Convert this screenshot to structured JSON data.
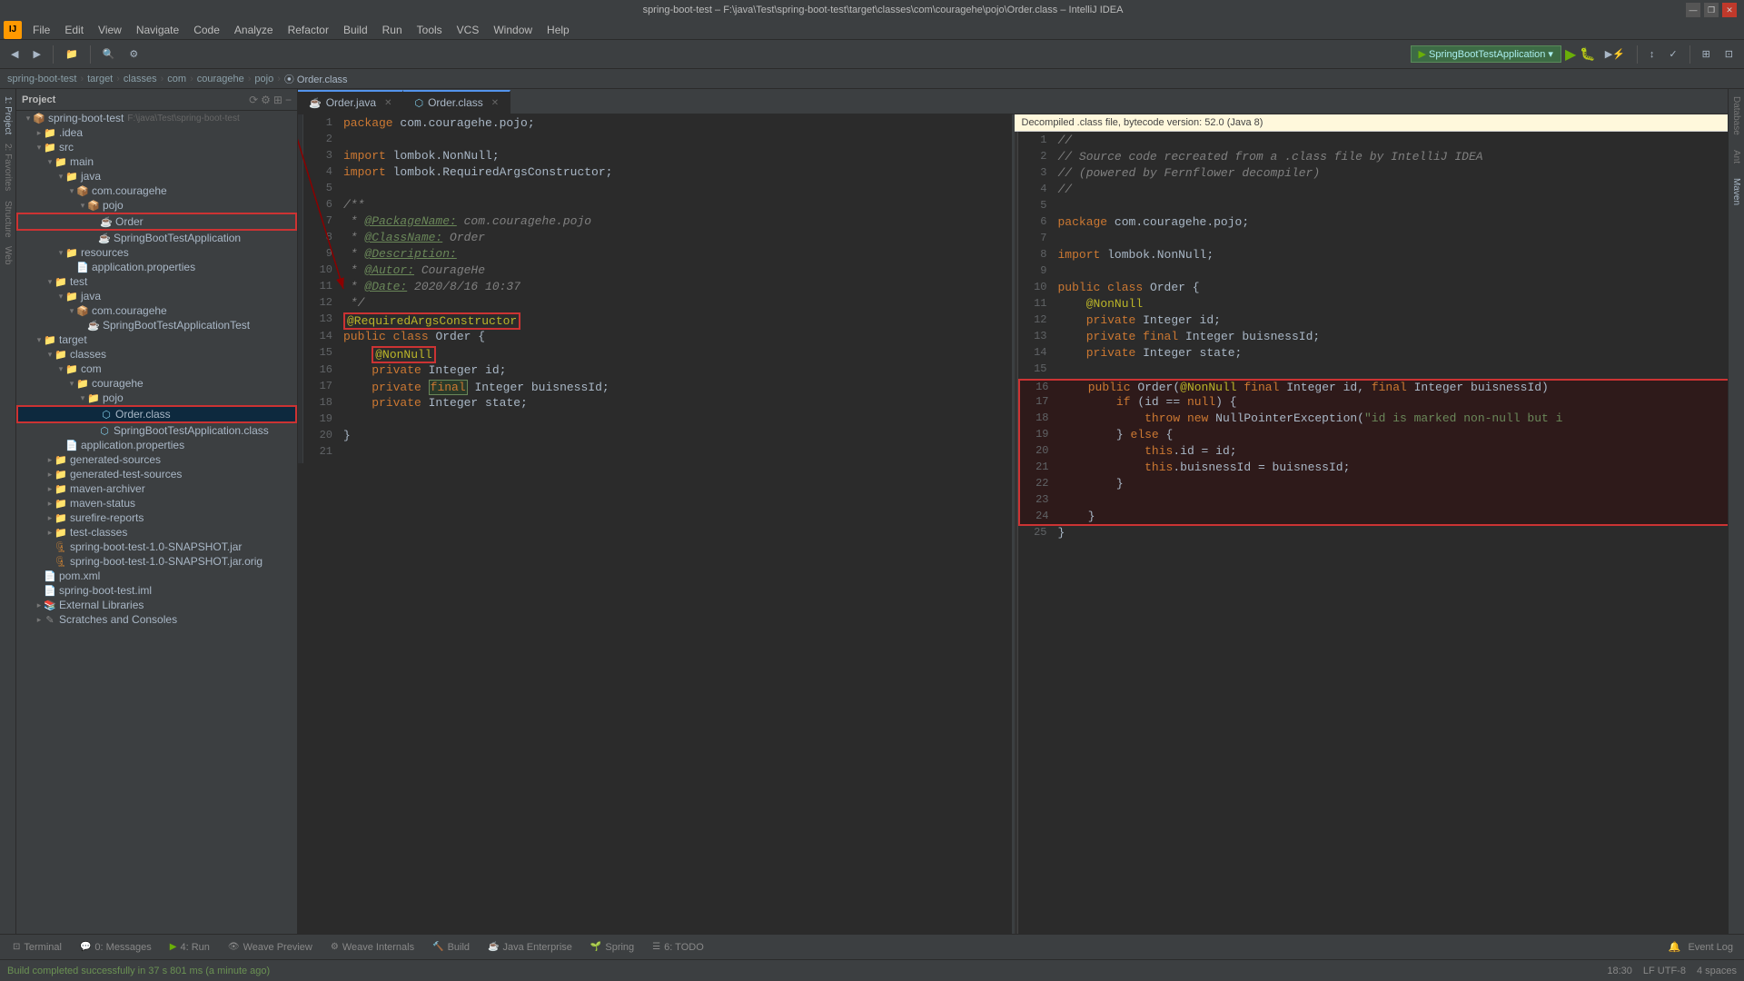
{
  "titlebar": {
    "title": "spring-boot-test – F:\\java\\Test\\spring-boot-test\\target\\classes\\com\\couragehe\\pojo\\Order.class – IntelliJ IDEA",
    "min": "—",
    "max": "❐",
    "close": "✕"
  },
  "menubar": {
    "items": [
      "File",
      "Edit",
      "View",
      "Navigate",
      "Code",
      "Analyze",
      "Refactor",
      "Build",
      "Run",
      "Tools",
      "VCS",
      "Window",
      "Help"
    ]
  },
  "breadcrumb": {
    "parts": [
      "spring-boot-test",
      "target",
      "classes",
      "com",
      "couragehe",
      "pojo"
    ],
    "file": "Order.class"
  },
  "sidebar": {
    "header": "Project",
    "tree": [
      {
        "label": "spring-boot-test F:\\java\\Test\\spring-boot-test",
        "level": 1,
        "type": "project",
        "arrow": "▾"
      },
      {
        "label": ".idea",
        "level": 2,
        "type": "folder",
        "arrow": "▸"
      },
      {
        "label": "src",
        "level": 2,
        "type": "folder",
        "arrow": "▾"
      },
      {
        "label": "main",
        "level": 3,
        "type": "folder",
        "arrow": "▾"
      },
      {
        "label": "java",
        "level": 4,
        "type": "folder",
        "arrow": "▾"
      },
      {
        "label": "com.couragehe",
        "level": 5,
        "type": "pkg",
        "arrow": "▾"
      },
      {
        "label": "pojo",
        "level": 6,
        "type": "pkg",
        "arrow": "▾"
      },
      {
        "label": "Order",
        "level": 7,
        "type": "java",
        "arrow": "",
        "redbox": true
      },
      {
        "label": "SpringBootTestApplication",
        "level": 7,
        "type": "java",
        "arrow": ""
      },
      {
        "label": "resources",
        "level": 4,
        "type": "folder",
        "arrow": "▾"
      },
      {
        "label": "application.properties",
        "level": 5,
        "type": "props",
        "arrow": ""
      },
      {
        "label": "test",
        "level": 3,
        "type": "folder",
        "arrow": "▾"
      },
      {
        "label": "java",
        "level": 4,
        "type": "folder",
        "arrow": "▾"
      },
      {
        "label": "com.couragehe",
        "level": 5,
        "type": "pkg",
        "arrow": "▾"
      },
      {
        "label": "SpringBootTestApplicationTest",
        "level": 6,
        "type": "java",
        "arrow": ""
      },
      {
        "label": "target",
        "level": 2,
        "type": "folder",
        "arrow": "▾"
      },
      {
        "label": "classes",
        "level": 3,
        "type": "folder",
        "arrow": "▾"
      },
      {
        "label": "com",
        "level": 4,
        "type": "folder",
        "arrow": "▾"
      },
      {
        "label": "couragehe",
        "level": 5,
        "type": "folder",
        "arrow": "▾"
      },
      {
        "label": "pojo",
        "level": 6,
        "type": "folder",
        "arrow": "▾"
      },
      {
        "label": "Order.class",
        "level": 7,
        "type": "class",
        "arrow": "",
        "selected": true
      },
      {
        "label": "SpringBootTestApplication.class",
        "level": 7,
        "type": "class",
        "arrow": ""
      },
      {
        "label": "application.properties",
        "level": 4,
        "type": "props",
        "arrow": ""
      },
      {
        "label": "generated-sources",
        "level": 3,
        "type": "folder",
        "arrow": "▸"
      },
      {
        "label": "generated-test-sources",
        "level": 3,
        "type": "folder",
        "arrow": "▸"
      },
      {
        "label": "maven-archiver",
        "level": 3,
        "type": "folder",
        "arrow": "▸"
      },
      {
        "label": "maven-status",
        "level": 3,
        "type": "folder",
        "arrow": "▸"
      },
      {
        "label": "surefire-reports",
        "level": 3,
        "type": "folder",
        "arrow": "▸"
      },
      {
        "label": "test-classes",
        "level": 3,
        "type": "folder",
        "arrow": "▸"
      },
      {
        "label": "spring-boot-test-1.0-SNAPSHOT.jar",
        "level": 3,
        "type": "jar",
        "arrow": ""
      },
      {
        "label": "spring-boot-test-1.0-SNAPSHOT.jar.orig",
        "level": 3,
        "type": "jar",
        "arrow": ""
      },
      {
        "label": "pom.xml",
        "level": 2,
        "type": "xml",
        "arrow": ""
      },
      {
        "label": "spring-boot-test.iml",
        "level": 2,
        "type": "iml",
        "arrow": ""
      },
      {
        "label": "External Libraries",
        "level": 2,
        "type": "lib",
        "arrow": "▸"
      },
      {
        "label": "Scratches and Consoles",
        "level": 2,
        "type": "scratches",
        "arrow": "▸"
      }
    ]
  },
  "editor_left": {
    "tab": "Order.java",
    "lines": [
      {
        "n": 1,
        "code": "package com.couragehe.pojo;"
      },
      {
        "n": 2,
        "code": ""
      },
      {
        "n": 3,
        "code": "import lombok.NonNull;"
      },
      {
        "n": 4,
        "code": "import lombok.RequiredArgsConstructor;"
      },
      {
        "n": 5,
        "code": ""
      },
      {
        "n": 6,
        "code": "/**"
      },
      {
        "n": 7,
        "code": " * @PackageName: com.couragehe.pojo"
      },
      {
        "n": 8,
        "code": " * @ClassName: Order"
      },
      {
        "n": 9,
        "code": " * @Description:"
      },
      {
        "n": 10,
        "code": " * @Autor: CourageHe"
      },
      {
        "n": 11,
        "code": " * @Date: 2020/8/16 10:37"
      },
      {
        "n": 12,
        "code": " */"
      },
      {
        "n": 13,
        "code": "@RequiredArgsConstructor"
      },
      {
        "n": 14,
        "code": "public class Order {"
      },
      {
        "n": 15,
        "code": "    @NonNull"
      },
      {
        "n": 16,
        "code": "    private Integer id;"
      },
      {
        "n": 17,
        "code": "    private final Integer buisnessId;"
      },
      {
        "n": 18,
        "code": "    private Integer state;"
      },
      {
        "n": 19,
        "code": ""
      },
      {
        "n": 20,
        "code": "}"
      },
      {
        "n": 21,
        "code": ""
      }
    ]
  },
  "editor_right": {
    "tab": "Order.class",
    "banner": "Decompiled .class file, bytecode version: 52.0 (Java 8)",
    "lines": [
      {
        "n": 1,
        "code": "//"
      },
      {
        "n": 2,
        "code": "// Source code recreated from a .class file by IntelliJ IDEA"
      },
      {
        "n": 3,
        "code": "// (powered by Fernflower decompiler)"
      },
      {
        "n": 4,
        "code": "//"
      },
      {
        "n": 5,
        "code": ""
      },
      {
        "n": 6,
        "code": "package com.couragehe.pojo;"
      },
      {
        "n": 7,
        "code": ""
      },
      {
        "n": 8,
        "code": "import lombok.NonNull;"
      },
      {
        "n": 9,
        "code": ""
      },
      {
        "n": 10,
        "code": "public class Order {"
      },
      {
        "n": 11,
        "code": "    @NonNull"
      },
      {
        "n": 12,
        "code": "    private Integer id;"
      },
      {
        "n": 13,
        "code": "    private final Integer buisnessId;"
      },
      {
        "n": 14,
        "code": "    private Integer state;"
      },
      {
        "n": 15,
        "code": ""
      },
      {
        "n": 16,
        "code": "    public Order(@NonNull final Integer id, final Integer buisnessId)"
      },
      {
        "n": 17,
        "code": "        if (id == null) {"
      },
      {
        "n": 18,
        "code": "            throw new NullPointerException(\"id is marked non-null but i"
      },
      {
        "n": 19,
        "code": "        } else {"
      },
      {
        "n": 20,
        "code": "            this.id = id;"
      },
      {
        "n": 21,
        "code": "            this.buisnessId = buisnessId;"
      },
      {
        "n": 22,
        "code": "        }"
      },
      {
        "n": 23,
        "code": ""
      },
      {
        "n": 24,
        "code": "    }"
      },
      {
        "n": 25,
        "code": "}"
      }
    ]
  },
  "status": {
    "build_msg": "Build completed successfully in 37 s 801 ms (a minute ago)",
    "position": "18:30",
    "encoding": "LF  UTF-8",
    "indent": "4 spaces"
  },
  "bottom_tabs": [
    {
      "label": "Terminal",
      "badge": ""
    },
    {
      "label": "0: Messages",
      "badge": ""
    },
    {
      "label": "4: Run",
      "badge": ""
    },
    {
      "label": "Weave Preview",
      "badge": ""
    },
    {
      "label": "Weave Internals",
      "badge": ""
    },
    {
      "label": "Build",
      "badge": ""
    },
    {
      "label": "Java Enterprise",
      "badge": ""
    },
    {
      "label": "Spring",
      "badge": ""
    },
    {
      "label": "6: TODO",
      "badge": ""
    }
  ],
  "run_config": "SpringBootTestApplication",
  "right_panels": [
    "Database",
    "Ant",
    "Maven"
  ],
  "left_panels": [
    "1: Project",
    "2: Favorites",
    "Structure",
    "Web"
  ]
}
